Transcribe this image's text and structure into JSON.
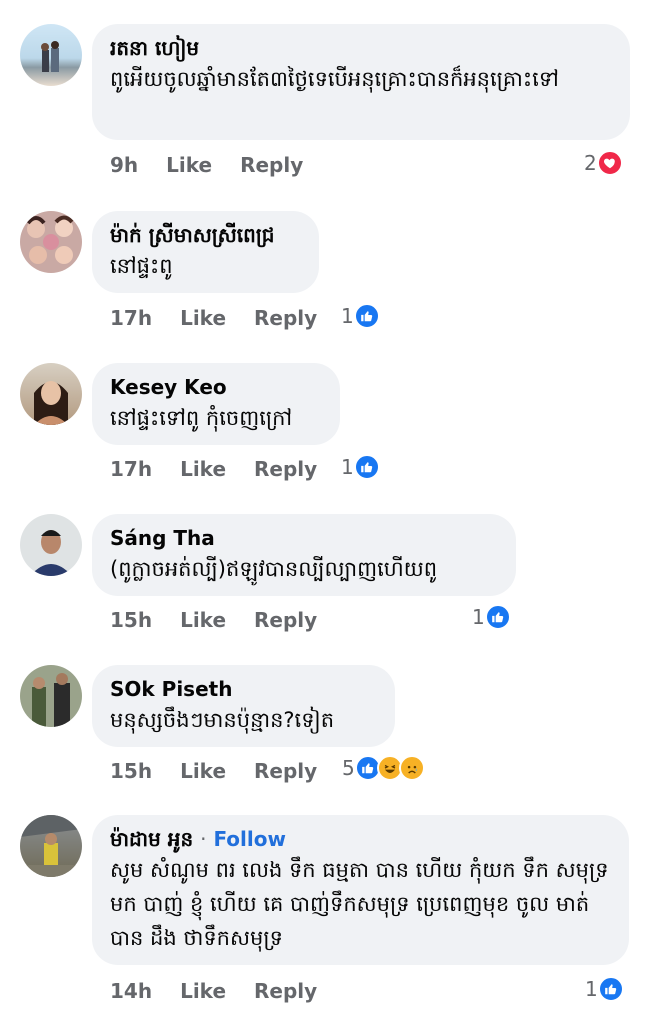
{
  "comments": [
    {
      "name": "រតនា ហៀម",
      "text": "ពូអើយចូលឆ្នាំមានតែ៣ថ្ងៃទេបើអនុគ្រោះបានក៏អនុគ្រោះទៅ",
      "time": "9h",
      "like": "Like",
      "reply": "Reply",
      "reaction_count": "2",
      "reactions": [
        "love-icon"
      ]
    },
    {
      "name": "ម៉ាក់ ស្រីមាសស្រីពេជ្រ",
      "text": "នៅផ្ទះពូ",
      "time": "17h",
      "like": "Like",
      "reply": "Reply",
      "reaction_count": "1",
      "reactions": [
        "like-icon"
      ]
    },
    {
      "name": "Kesey Keo",
      "text": "នៅផ្ទះទៅពូ កុំចេញក្រៅ",
      "time": "17h",
      "like": "Like",
      "reply": "Reply",
      "reaction_count": "1",
      "reactions": [
        "like-icon"
      ]
    },
    {
      "name": "Sáng Tha",
      "text": "(ពូក្លាចអត់ល្បី)ឥឡូវបានល្បីល្បាញហើយពូ",
      "time": "15h",
      "like": "Like",
      "reply": "Reply",
      "reaction_count": "1",
      "reactions": [
        "like-icon"
      ]
    },
    {
      "name": "SOk Piseth",
      "text": "មនុស្សចឹងៗមានប៉ុន្មាន?ទៀត",
      "time": "15h",
      "like": "Like",
      "reply": "Reply",
      "reaction_count": "5",
      "reactions": [
        "like-icon",
        "haha-icon",
        "sad-icon"
      ]
    },
    {
      "name": "ម៉ាដាម អូន",
      "follow_sep": "·",
      "follow": "Follow",
      "text": "សូម សំណូម ពរ លេង ទឹក ធម្មតា បាន ហើយ កុំយក ទឹក សមុទ្រ មក បាញ់ ខ្ញុំ ហើយ គេ បាញ់ទឹកសមុទ្រ ប្រេពេញមុខ ចូល មាត់ បាន ដឹង ថាទឹកសមុទ្រ",
      "time": "14h",
      "like": "Like",
      "reply": "Reply",
      "reaction_count": "1",
      "reactions": [
        "like-icon"
      ]
    }
  ],
  "colors": {
    "like_blue": "#1877f2",
    "love_red": "#f02849",
    "haha_yellow": "#f7b125",
    "bubble_bg": "#f0f2f5",
    "meta_gray": "#65676b",
    "follow_blue": "#216fdb"
  }
}
